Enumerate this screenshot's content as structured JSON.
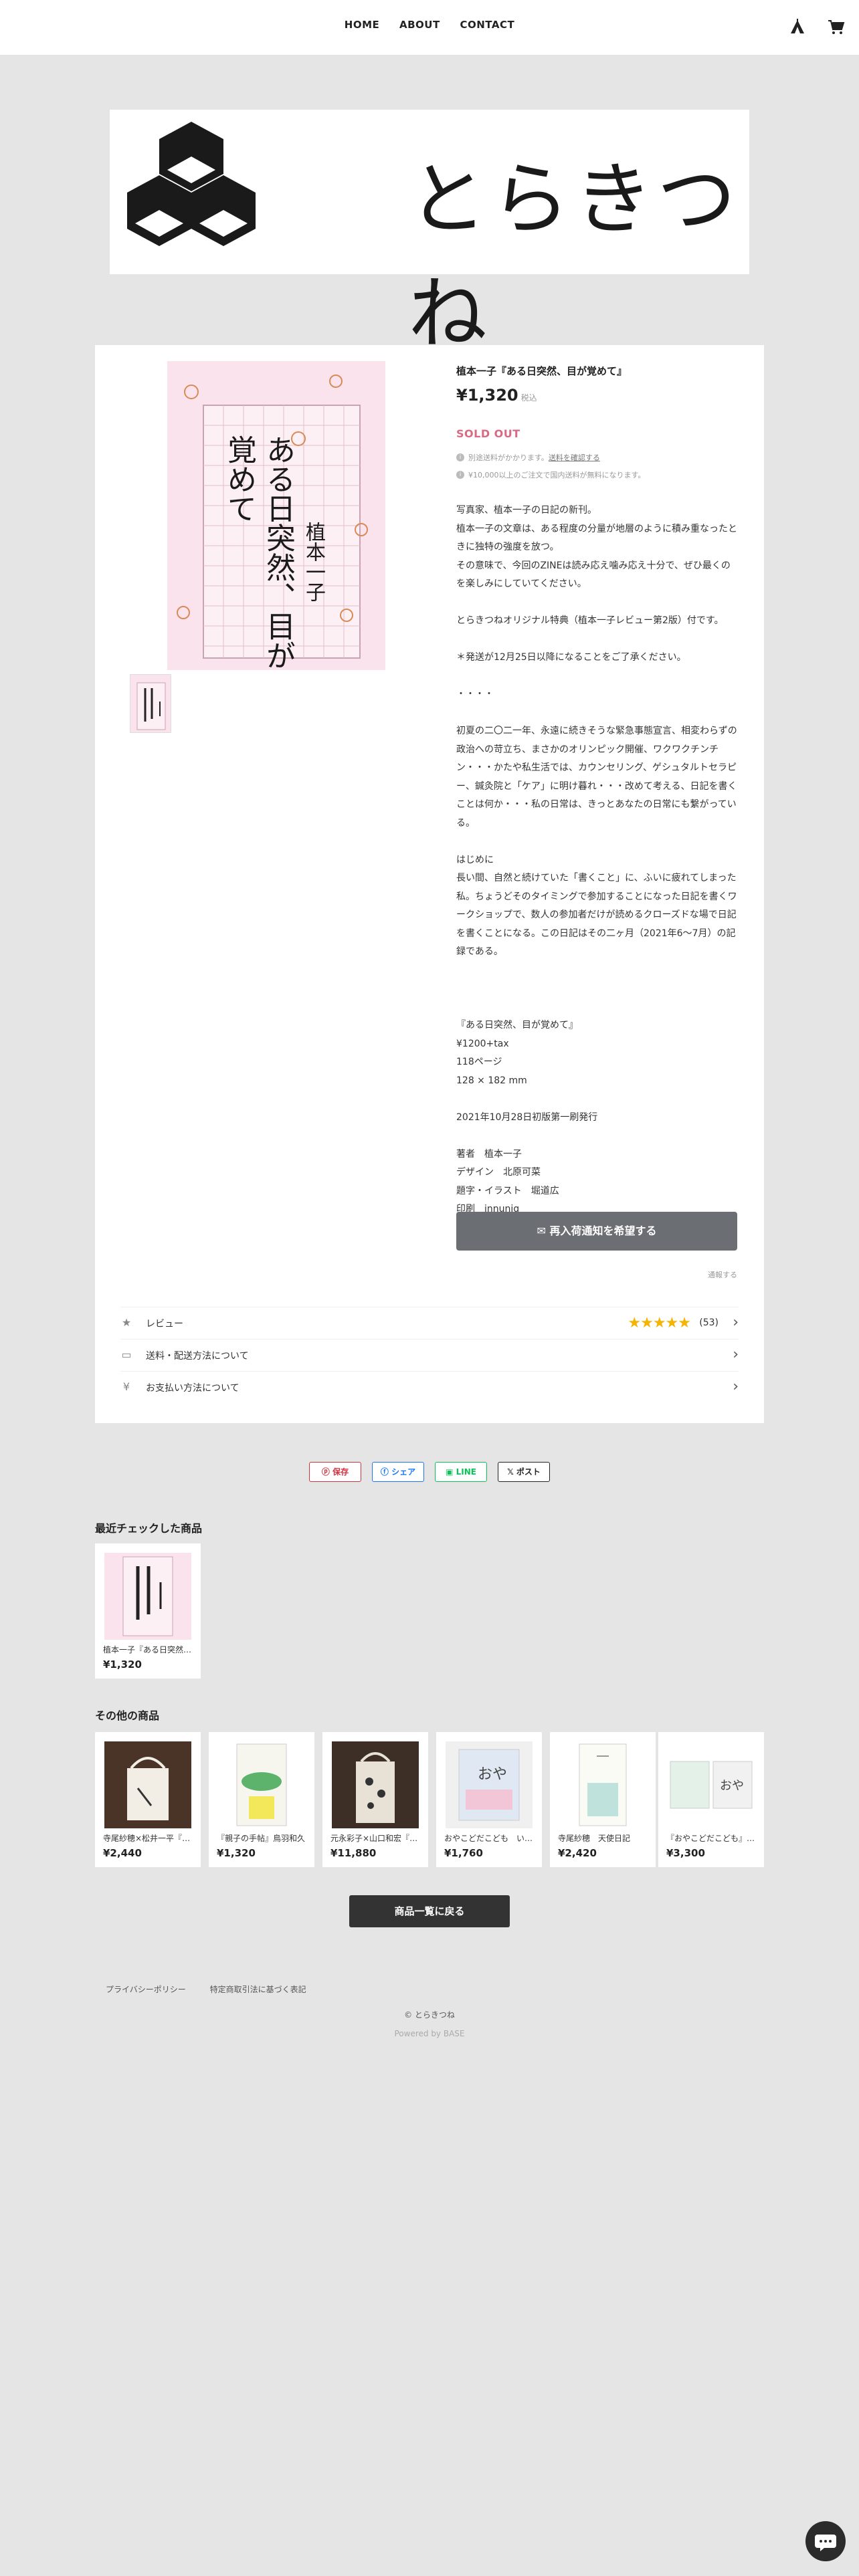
{
  "nav": {
    "items": [
      "HOME",
      "ABOUT",
      "CONTACT"
    ]
  },
  "header": {
    "icons": [
      "tent-logo-icon",
      "cart-icon"
    ]
  },
  "logo": {
    "text": "とらきつね"
  },
  "product": {
    "title": "植本一子『ある日突然、目が覚めて』",
    "price": "¥1,320",
    "tax_note": "税込",
    "status": "SOLD OUT",
    "shipping_note_prefix": "別途送料がかかります。",
    "shipping_note_link": "送料を確認する",
    "free_shipping_note": "¥10,000以上のご注文で国内送料が無料になります。",
    "cover_title": "ある日突然、目が覚めて",
    "cover_author": "植本一子",
    "description": "写真家、植本一子の日記の新刊。\n植本一子の文章は、ある程度の分量が地層のように積み重なったときに独特の強度を放つ。\nその意味で、今回のZINEは読み応え噛み応え十分で、ぜひ最くのを楽しみにしていてください。\n\nとらきつねオリジナル特典（植本一子レビュー第2版）付です。\n\n＊発送が12月25日以降になることをご了承ください。\n\n・・・・\n\n初夏の二〇二一年、永遠に続きそうな緊急事態宣言、相変わらずの政治への苛立ち、まさかのオリンピック開催、ワクワクチンチン・・・かたや私生活では、カウンセリング、ゲシュタルトセラピー、鍼灸院と「ケア」に明け暮れ・・・改めて考える、日記を書くことは何か・・・私の日常は、きっとあなたの日常にも繋がっている。\n\nはじめに\n長い間、自然と続けていた「書くこと」に、ふいに疲れてしまった私。ちょうどそのタイミングで参加することになった日記を書くワークショップで、数人の参加者だけが読めるクローズドな場で日記を書くことになる。この日記はその二ヶ月（2021年6〜7月）の記録である。\n\n\n\n『ある日突然、目が覚めて』\n¥1200+tax\n118ページ\n128 × 182 mm\n\n2021年10月28日初版第一刷発行\n\n著者　植本一子\nデザイン　北原可菜\n題字・イラスト　堀道広\n印刷　innuniq"
  },
  "actions": {
    "notify_label": "再入荷通知を希望する",
    "report_link": "通報する"
  },
  "info_rows": [
    {
      "label": "レビュー",
      "icon": "star-icon"
    },
    {
      "label": "送料・配送方法について",
      "icon": "truck-icon"
    },
    {
      "label": "お支払い方法について",
      "icon": "yen-icon"
    }
  ],
  "review": {
    "stars": "★★★★★",
    "count": "(53)"
  },
  "share": {
    "save": "保存",
    "facebook": "シェア",
    "line": "LINE",
    "x": "ポスト"
  },
  "recently_viewed": {
    "title": "最近チェックした商品",
    "items": [
      {
        "name": "植本一子『ある日突然、目が覚めて』",
        "price": "¥1,320"
      }
    ]
  },
  "other_products": {
    "title": "その他の商品",
    "items": [
      {
        "name": "寺尾紗穂×松井一平『手で行くミ』",
        "price": "¥2,440"
      },
      {
        "name": "『親子の手帖』鳥羽和久",
        "price": "¥1,320"
      },
      {
        "name": "元永彩子×山口和宏『ぬぬぬ』",
        "price": "¥11,880"
      },
      {
        "name": "おやこどだこども　いせひでこ",
        "price": "¥1,760"
      },
      {
        "name": "寺尾紗穂　天使日記",
        "price": "¥2,420"
      },
      {
        "name": "『おやこどだこども』いせひでこ",
        "price": "¥3,300"
      }
    ]
  },
  "back_button": "商品一覧に戻る",
  "footer": {
    "links": [
      "プライバシーポリシー",
      "特定商取引法に基づく表記"
    ],
    "copyright": "© とらきつね",
    "powered": "Powered by BASE"
  },
  "colors": {
    "background": "#e5e5e5",
    "soldout": "#d96a84",
    "notify_button": "#6b6e73",
    "star": "#f5b400",
    "back_button": "#333333"
  }
}
